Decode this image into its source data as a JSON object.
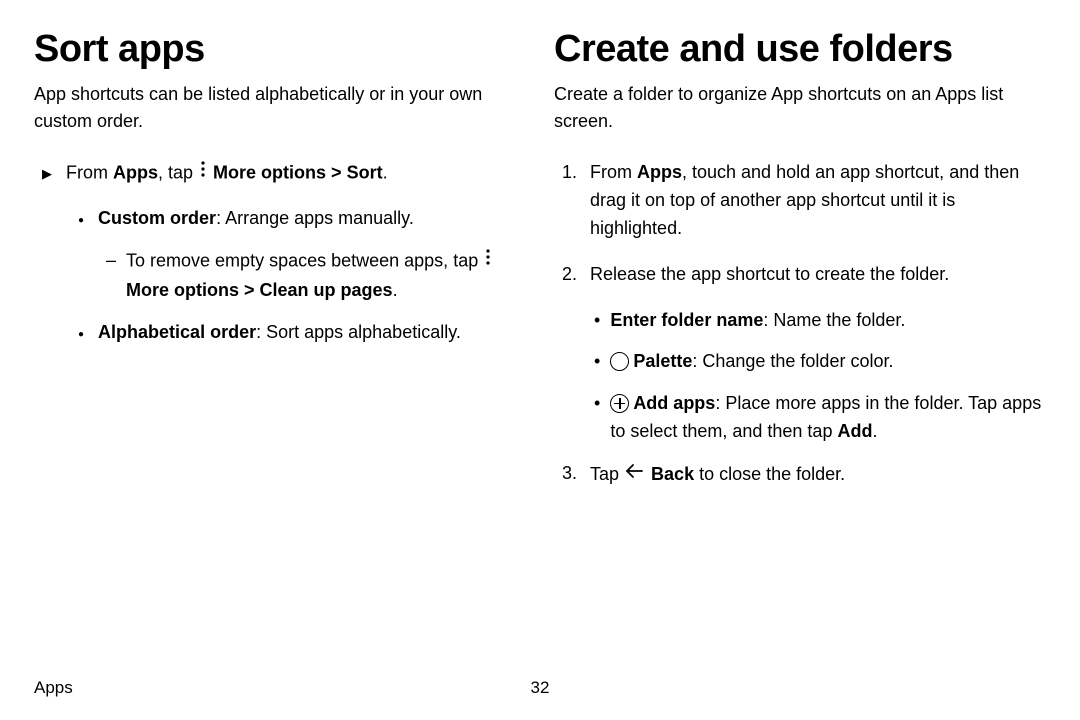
{
  "left": {
    "heading": "Sort apps",
    "intro": "App shortcuts can be listed alphabetically or in your own custom order.",
    "from1": "From ",
    "apps_bold": "Apps",
    "from2": ", tap ",
    "more_opts": "More options",
    "sort_sep": " > ",
    "sort_bold": "Sort",
    "period": ".",
    "custom_bold": "Custom order",
    "custom_rest": ": Arrange apps manually.",
    "remove1": "To remove empty spaces between apps, tap ",
    "cleanup_bold": "Clean up pages",
    "alpha_bold": "Alphabetical order",
    "alpha_rest": ": Sort apps alphabetically."
  },
  "right": {
    "heading": "Create and use folders",
    "intro": "Create a folder to organize App shortcuts on an Apps list screen.",
    "step1_a": "From ",
    "step1_apps": "Apps",
    "step1_b": ", touch and hold an app shortcut, and then drag it on top of another app shortcut until it is highlighted.",
    "step2": "Release the app shortcut to create the folder.",
    "enter_bold": "Enter folder name",
    "enter_rest": ": Name the folder.",
    "palette_bold": "Palette",
    "palette_rest": ": Change the folder color.",
    "addapps_bold": "Add apps",
    "addapps_rest": ": Place more apps in the folder. Tap apps to select them, and then tap ",
    "add_bold": "Add",
    "step3_a": "Tap ",
    "back_bold": "Back",
    "step3_b": " to close the folder.",
    "n1": "1.",
    "n2": "2.",
    "n3": "3."
  },
  "footer": {
    "section": "Apps",
    "page": "32"
  }
}
